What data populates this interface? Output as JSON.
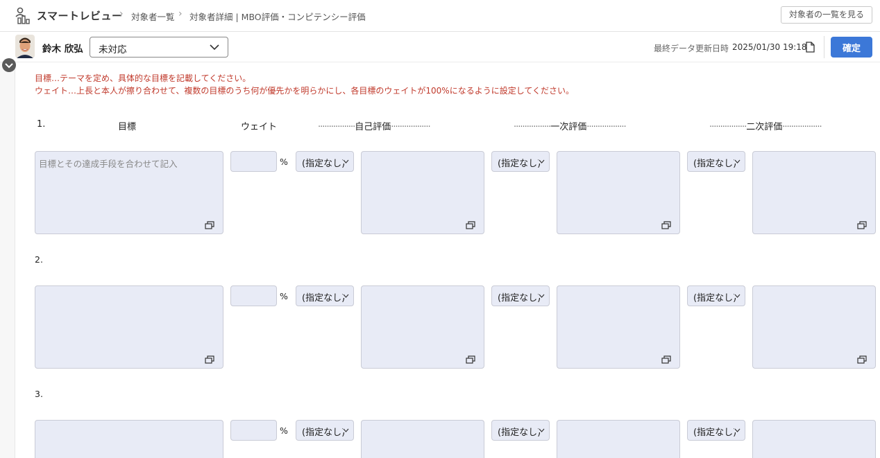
{
  "header": {
    "app_title": "スマートレビュー",
    "breadcrumbs": [
      "対象者一覧",
      "対象者詳細 | MBO評価・コンピテンシー評価"
    ],
    "list_button": "対象者の一覧を見る"
  },
  "subject": {
    "name": "鈴木 欣弘",
    "status": "未対応",
    "updated_label": "最終データ更新日時",
    "updated_value": "2025/01/30 19:18",
    "confirm_button": "確定"
  },
  "notes": [
    "目標…テーマを定め、具体的な目標を記載してください。",
    "ウェイト…上長と本人が擦り合わせて、複数の目標のうち何が優先かを明らかにし、各目標のウェイトが100%になるように設定してください。"
  ],
  "columns": {
    "goal": "目標",
    "weight": "ウェイト",
    "self": "自己評価",
    "first": "一次評価",
    "second": "二次評価"
  },
  "rows": [
    {
      "number": "1.",
      "goal_placeholder": "目標とその達成手段を合わせて記入",
      "weight_unit": "%",
      "self_grade": "(指定なし)",
      "first_grade": "(指定なし)",
      "second_grade": "(指定なし)"
    },
    {
      "number": "2.",
      "goal_placeholder": "",
      "weight_unit": "%",
      "self_grade": "(指定なし)",
      "first_grade": "(指定なし)",
      "second_grade": "(指定なし)"
    },
    {
      "number": "3.",
      "goal_placeholder": "",
      "weight_unit": "%",
      "self_grade": "(指定なし)",
      "first_grade": "(指定なし)",
      "second_grade": "(指定なし)"
    }
  ],
  "colors": {
    "accent": "#3c78d8",
    "note_text": "#c0392b",
    "field_bg": "#e8ebf6"
  }
}
